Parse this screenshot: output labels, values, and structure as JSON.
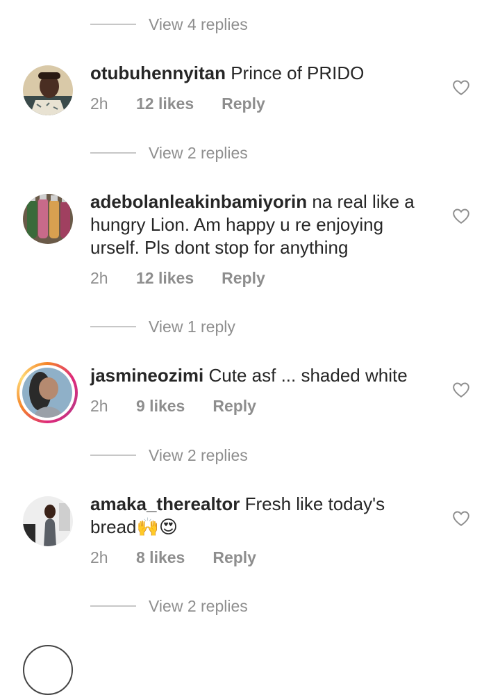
{
  "top_replies": "View 4 replies",
  "comments": [
    {
      "username": "otubuhennyitan",
      "text": "Prince of PRIDO",
      "time": "2h",
      "likes": "12 likes",
      "reply": "Reply",
      "view_replies": "View 2 replies"
    },
    {
      "username": "adebolanleakinbamiyorin",
      "text": "na real like a hungry Lion. Am happy u re enjoying urself. Pls dont stop for anything",
      "time": "2h",
      "likes": "12 likes",
      "reply": "Reply",
      "view_replies": "View 1 reply"
    },
    {
      "username": "jasmineozimi",
      "text": "Cute asf ... shaded white",
      "time": "2h",
      "likes": "9 likes",
      "reply": "Reply",
      "view_replies": "View 2 replies"
    },
    {
      "username": "amaka_therealtor",
      "text": "Fresh like today's bread",
      "emojis": "🙌😍",
      "time": "2h",
      "likes": "8 likes",
      "reply": "Reply",
      "view_replies": "View 2 replies"
    }
  ],
  "colors": {
    "text": "#262626",
    "secondary": "#8e8e8e",
    "divider": "#c7c7c7"
  }
}
